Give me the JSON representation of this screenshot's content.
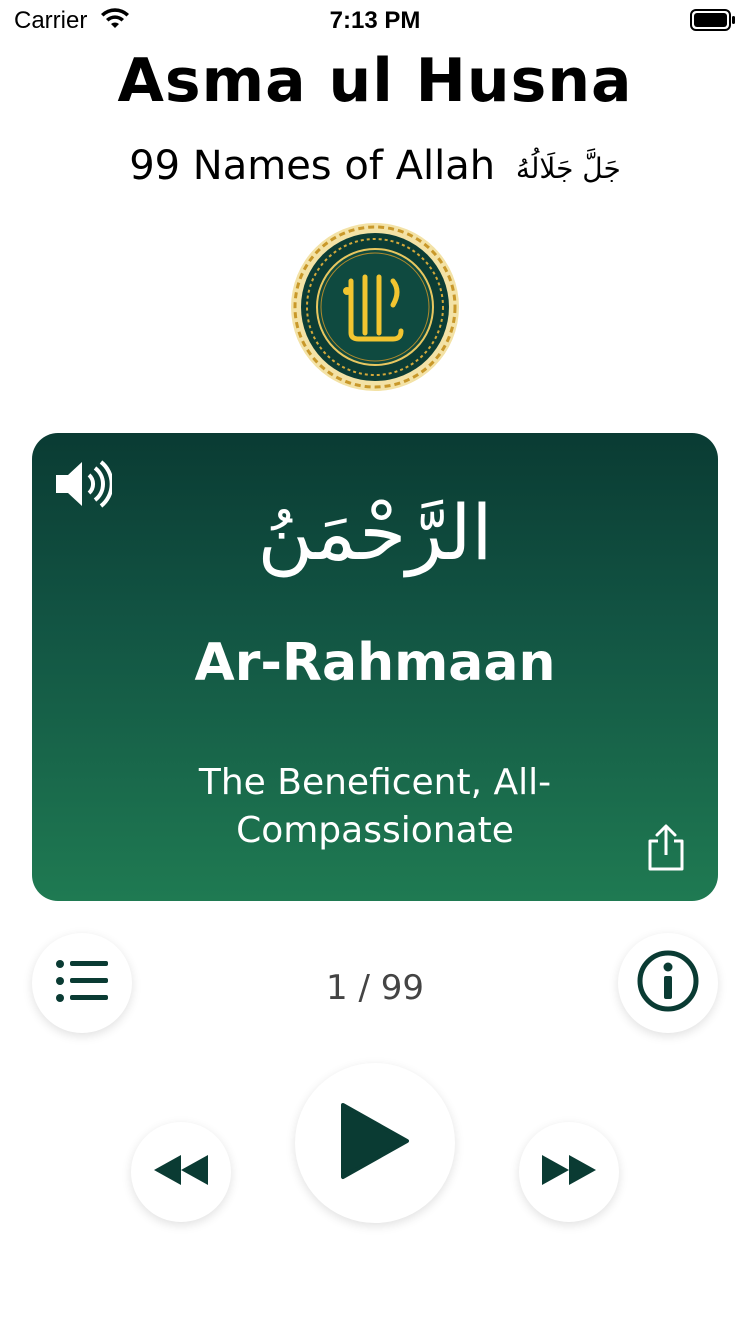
{
  "status_bar": {
    "carrier": "Carrier",
    "time": "7:13 PM"
  },
  "header": {
    "title": "Asma ul Husna",
    "subtitle": "99 Names of  Allah",
    "honorific": "جَلَّ جَلَالُهُ"
  },
  "card": {
    "arabic": "الرَّحْمَنُ",
    "transliteration": "Ar-Rahmaan",
    "meaning": "The Beneficent, All-Compassionate"
  },
  "navigation": {
    "counter": "1 / 99"
  },
  "colors": {
    "accent": "#0a3b33",
    "card_top": "#0a3b33",
    "card_bottom": "#1f7a52",
    "gold": "#d4a93a"
  },
  "icons": {
    "speaker": "speaker-icon",
    "share": "share-icon",
    "list": "list-icon",
    "info": "info-icon",
    "rewind": "rewind-icon",
    "play": "play-icon",
    "fast_forward": "fast-forward-icon"
  }
}
